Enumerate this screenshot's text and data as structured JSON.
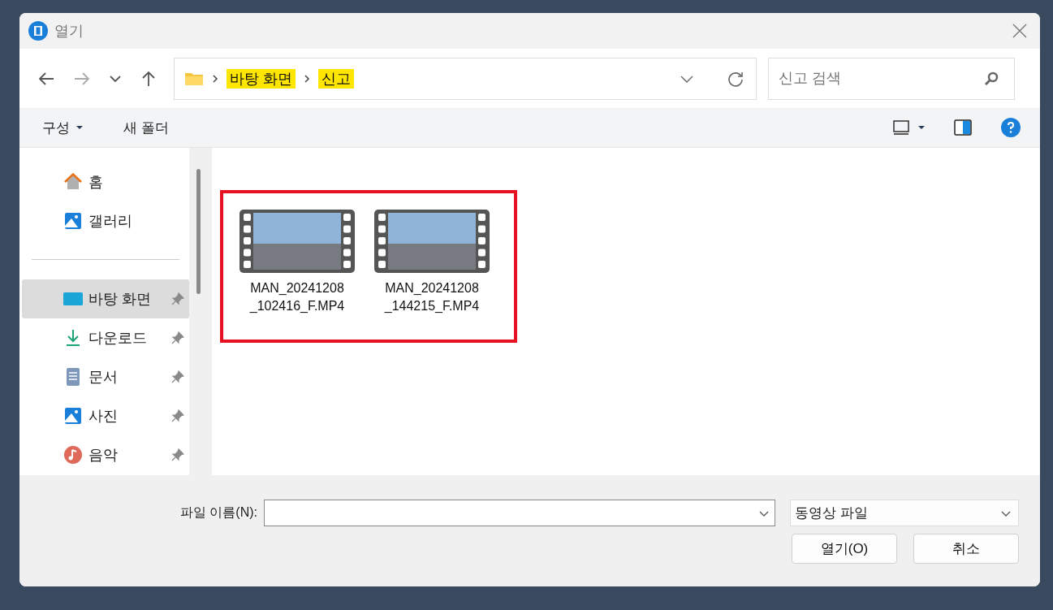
{
  "window": {
    "title": "열기"
  },
  "address_bar": {
    "path": [
      {
        "label": "바탕 화면",
        "highlighted": true
      },
      {
        "label": "신고",
        "highlighted": true
      }
    ]
  },
  "search": {
    "placeholder": "신고 검색"
  },
  "toolbar": {
    "organize": "구성",
    "new_folder": "새 폴더"
  },
  "sidebar": {
    "quick": [
      {
        "label": "홈",
        "kind": "home",
        "selected": false,
        "pinned": false
      },
      {
        "label": "갤러리",
        "kind": "gallery",
        "selected": false,
        "pinned": false
      }
    ],
    "places": [
      {
        "label": "바탕 화면",
        "kind": "desktop",
        "selected": true,
        "pinned": true
      },
      {
        "label": "다운로드",
        "kind": "download",
        "selected": false,
        "pinned": true
      },
      {
        "label": "문서",
        "kind": "document",
        "selected": false,
        "pinned": true
      },
      {
        "label": "사진",
        "kind": "pictures",
        "selected": false,
        "pinned": true
      },
      {
        "label": "음악",
        "kind": "music",
        "selected": false,
        "pinned": true
      }
    ]
  },
  "files": [
    {
      "name": "MAN_20241208_102416_F.MP4",
      "selected": false
    },
    {
      "name": "MAN_20241208_144215_F.MP4",
      "selected": false
    }
  ],
  "footer": {
    "file_name_label": "파일 이름(N):",
    "file_type": "동영상 파일",
    "open_button": "열기(O)",
    "cancel_button": "취소"
  }
}
